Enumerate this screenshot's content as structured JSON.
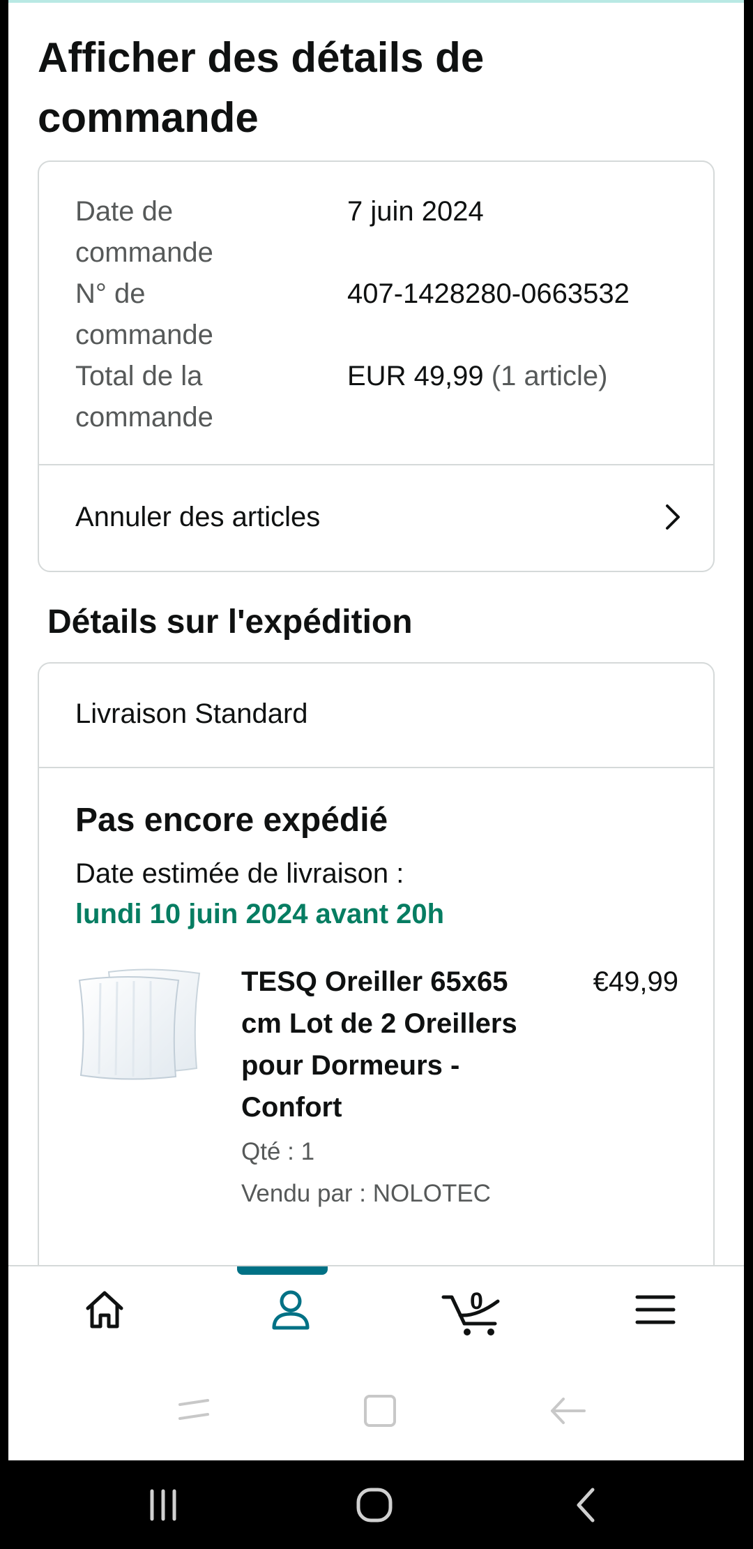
{
  "page": {
    "title": "Afficher des détails de commande"
  },
  "order": {
    "rows": [
      {
        "label": "Date de commande",
        "value": "7 juin 2024",
        "extra": ""
      },
      {
        "label": "N° de commande",
        "value": "407-1428280-0663532",
        "extra": ""
      },
      {
        "label": "Total de la commande",
        "value": "EUR 49,99",
        "extra": "(1 article)"
      }
    ],
    "cancel_label": "Annuler des articles"
  },
  "shipping": {
    "section_title": "Détails sur l'expédition",
    "delivery_type": "Livraison Standard",
    "status": "Pas encore expédié",
    "estimated_label": "Date estimée de livraison :",
    "estimated_date": "lundi 10 juin 2024 avant 20h",
    "estimated_date_color": "#067d62"
  },
  "item": {
    "title": "TESQ Oreiller 65x65 cm Lot de 2 Oreillers pour Dormeurs - Confort",
    "price": "€49,99",
    "quantity": "Qté : 1",
    "seller": "Vendu par : NOLOTEC",
    "image_icon": "pillow-image"
  },
  "bottom_nav": {
    "items": [
      {
        "icon": "home-icon"
      },
      {
        "icon": "account-icon",
        "active": true
      },
      {
        "icon": "cart-icon",
        "count": "0"
      },
      {
        "icon": "menu-icon"
      }
    ],
    "active_color": "#007185"
  },
  "colors": {
    "accent": "#007185",
    "success": "#067d62",
    "border": "#d5d9d9",
    "muted_text": "#565959"
  }
}
